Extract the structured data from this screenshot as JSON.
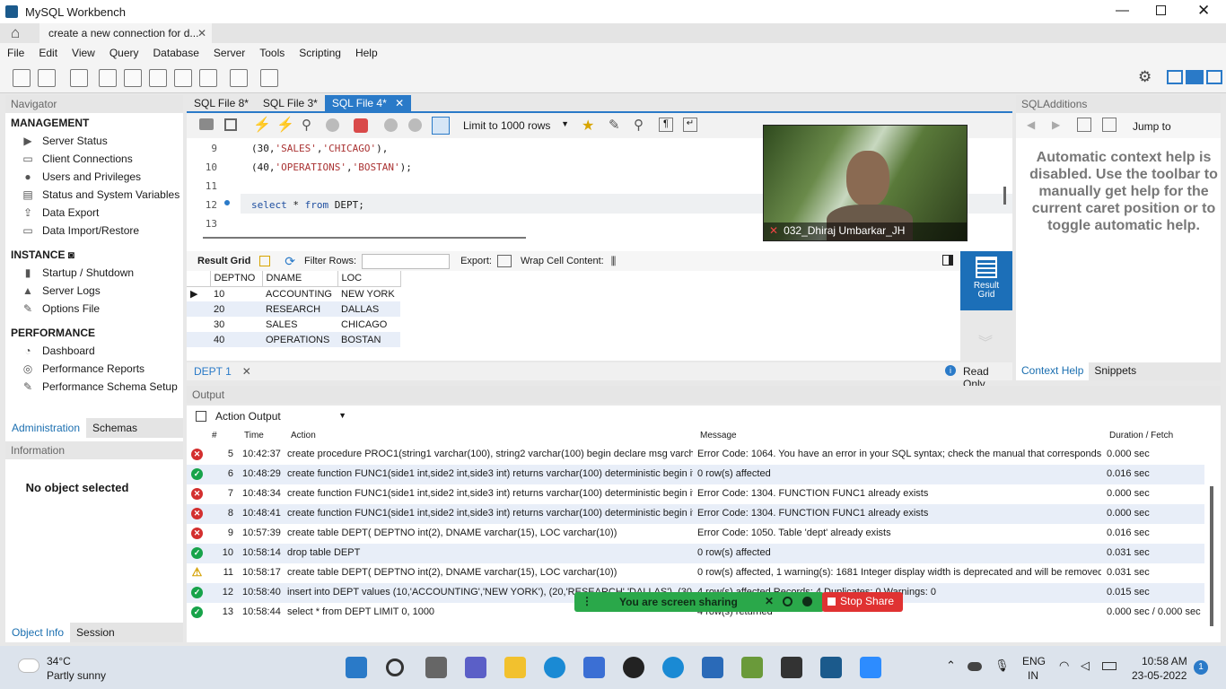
{
  "window": {
    "title": "MySQL Workbench",
    "connection_tab": "create a new connection for d..."
  },
  "menu": [
    "File",
    "Edit",
    "View",
    "Query",
    "Database",
    "Server",
    "Tools",
    "Scripting",
    "Help"
  ],
  "navigator": {
    "header": "Navigator",
    "management_title": "MANAGEMENT",
    "management": [
      "Server Status",
      "Client Connections",
      "Users and Privileges",
      "Status and System Variables",
      "Data Export",
      "Data Import/Restore"
    ],
    "instance_title": "INSTANCE",
    "instance": [
      "Startup / Shutdown",
      "Server Logs",
      "Options File"
    ],
    "performance_title": "PERFORMANCE",
    "performance": [
      "Dashboard",
      "Performance Reports",
      "Performance Schema Setup"
    ],
    "tabs": [
      "Administration",
      "Schemas"
    ],
    "info_header": "Information",
    "no_object": "No object selected",
    "bottom_tabs": [
      "Object Info",
      "Session"
    ]
  },
  "editor": {
    "tabs": [
      "SQL File 8*",
      "SQL File 3*",
      "SQL File 4*"
    ],
    "limit": "Limit to 1000 rows",
    "lines": [
      {
        "n": "9",
        "text": "(30,'SALES','CHICAGO'),"
      },
      {
        "n": "10",
        "text": "(40,'OPERATIONS','BOSTAN');"
      },
      {
        "n": "11",
        "text": ""
      },
      {
        "n": "12",
        "text": "select * from DEPT;"
      },
      {
        "n": "13",
        "text": ""
      }
    ]
  },
  "result": {
    "grid_label": "Result Grid",
    "filter_label": "Filter Rows:",
    "export_label": "Export:",
    "wrap_label": "Wrap Cell Content:",
    "side_button": "Result Grid",
    "columns": [
      "DEPTNO",
      "DNAME",
      "LOC"
    ],
    "rows": [
      [
        "10",
        "ACCOUNTING",
        "NEW YORK"
      ],
      [
        "20",
        "RESEARCH",
        "DALLAS"
      ],
      [
        "30",
        "SALES",
        "CHICAGO"
      ],
      [
        "40",
        "OPERATIONS",
        "BOSTAN"
      ]
    ],
    "tab": "DEPT 1",
    "read_only": "Read Only"
  },
  "sqladditions": {
    "header": "SQLAdditions",
    "jump_to": "Jump to",
    "help_text": "Automatic context help is disabled. Use the toolbar to manually get help for the current caret position or to toggle automatic help.",
    "tabs": [
      "Context Help",
      "Snippets"
    ]
  },
  "video": {
    "name": "032_Dhiraj Umbarkar_JH"
  },
  "output": {
    "header": "Output",
    "selector": "Action Output",
    "columns": [
      "#",
      "Time",
      "Action",
      "Message",
      "Duration / Fetch"
    ],
    "rows": [
      {
        "status": "error",
        "n": "5",
        "time": "10:42:37",
        "action": "create procedure PROC1(string1 varchar(100), string2 varchar(100) begin declare msg varch...",
        "message": "Error Code: 1064. You have an error in your SQL syntax; check the manual that corresponds ...",
        "duration": "0.000 sec"
      },
      {
        "status": "ok",
        "n": "6",
        "time": "10:48:29",
        "action": "create function FUNC1(side1 int,side2 int,side3 int) returns varchar(100) deterministic begin if ...",
        "message": "0 row(s) affected",
        "duration": "0.016 sec"
      },
      {
        "status": "error",
        "n": "7",
        "time": "10:48:34",
        "action": "create function FUNC1(side1 int,side2 int,side3 int) returns varchar(100) deterministic begin if ...",
        "message": "Error Code: 1304. FUNCTION FUNC1 already exists",
        "duration": "0.000 sec"
      },
      {
        "status": "error",
        "n": "8",
        "time": "10:48:41",
        "action": "create function FUNC1(side1 int,side2 int,side3 int) returns varchar(100) deterministic begin if ...",
        "message": "Error Code: 1304. FUNCTION FUNC1 already exists",
        "duration": "0.000 sec"
      },
      {
        "status": "error",
        "n": "9",
        "time": "10:57:39",
        "action": "create table DEPT( DEPTNO int(2), DNAME varchar(15), LOC varchar(10))",
        "message": "Error Code: 1050. Table 'dept' already exists",
        "duration": "0.016 sec"
      },
      {
        "status": "ok",
        "n": "10",
        "time": "10:58:14",
        "action": "drop table DEPT",
        "message": "0 row(s) affected",
        "duration": "0.031 sec"
      },
      {
        "status": "warn",
        "n": "11",
        "time": "10:58:17",
        "action": "create table DEPT( DEPTNO int(2), DNAME varchar(15), LOC varchar(10))",
        "message": "0 row(s) affected, 1 warning(s): 1681 Integer display width is deprecated and will be removed ...",
        "duration": "0.031 sec"
      },
      {
        "status": "ok",
        "n": "12",
        "time": "10:58:40",
        "action": "insert into DEPT values (10,'ACCOUNTING','NEW YORK'), (20,'RESEARCH','DALLAS'), (30 ...",
        "message": "4 row(s) affected Records: 4  Duplicates: 0  Warnings: 0",
        "duration": "0.015 sec"
      },
      {
        "status": "ok",
        "n": "13",
        "time": "10:58:44",
        "action": "select * from DEPT LIMIT 0, 1000",
        "message": "4 row(s) returned",
        "duration": "0.000 sec / 0.000 sec"
      }
    ]
  },
  "sharing": {
    "text": "You are screen sharing",
    "stop": "Stop Share"
  },
  "taskbar": {
    "temp": "34°C",
    "weather": "Partly sunny",
    "lang1": "ENG",
    "lang2": "IN",
    "time": "10:58 AM",
    "date": "23-05-2022",
    "badge": "1"
  },
  "colors": {
    "accent": "#2a7ac8",
    "ok": "#17a34a",
    "error": "#d32f2f",
    "warn": "#d4a000"
  }
}
